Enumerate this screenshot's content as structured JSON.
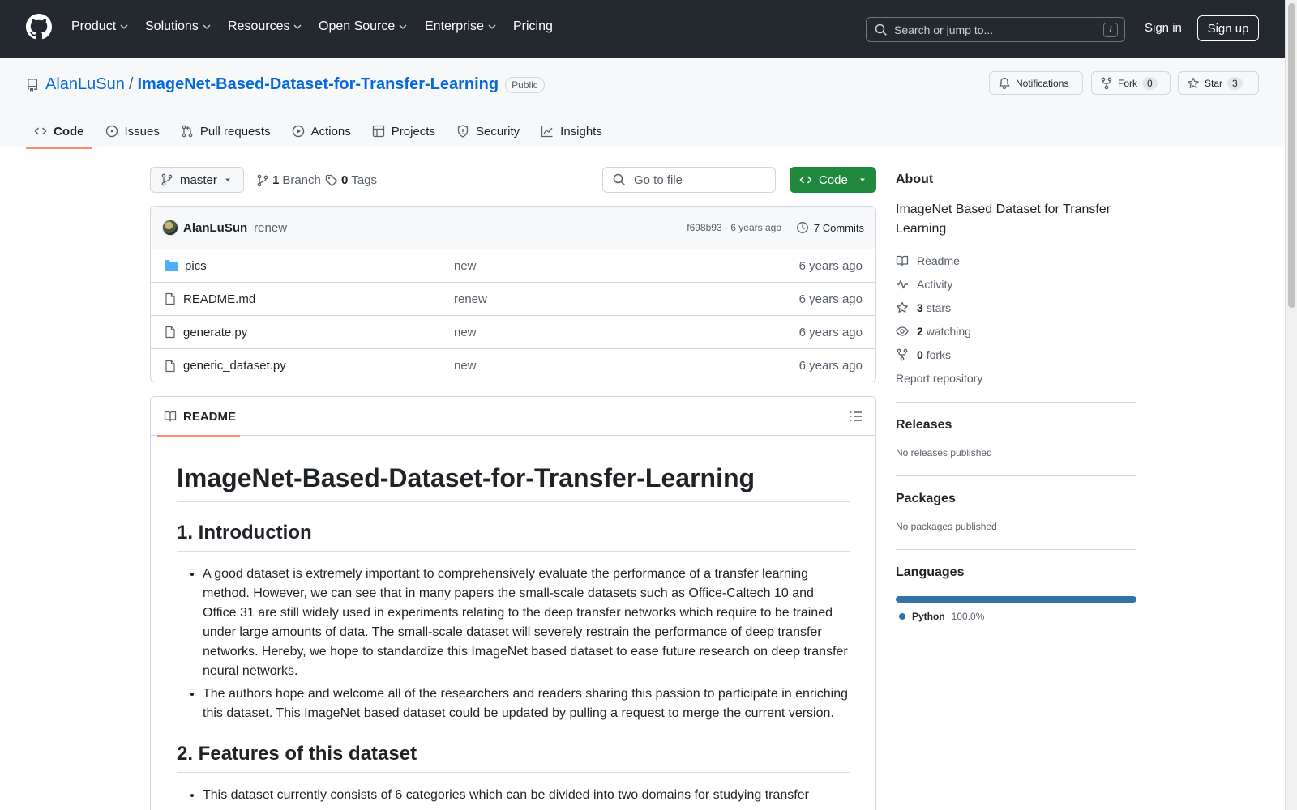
{
  "header": {
    "nav": [
      "Product",
      "Solutions",
      "Resources",
      "Open Source",
      "Enterprise",
      "Pricing"
    ],
    "search_placeholder": "Search or jump to...",
    "search_key": "/",
    "sign_in": "Sign in",
    "sign_up": "Sign up"
  },
  "repo": {
    "owner": "AlanLuSun",
    "separator": "/",
    "name": "ImageNet-Based-Dataset-for-Transfer-Learning",
    "visibility": "Public",
    "notifications": "Notifications",
    "fork_label": "Fork",
    "fork_count": "0",
    "star_label": "Star",
    "star_count": "3"
  },
  "tabs": [
    "Code",
    "Issues",
    "Pull requests",
    "Actions",
    "Projects",
    "Security",
    "Insights"
  ],
  "toolbar": {
    "branch": "master",
    "branch_count": "1",
    "branch_label": "Branch",
    "tag_count": "0",
    "tag_label": "Tags",
    "go_to_file": "Go to file",
    "code_button": "Code"
  },
  "commit": {
    "author": "AlanLuSun",
    "message": "renew",
    "hash_time": "f698b93 · 6 years ago",
    "commits": "7 Commits"
  },
  "files": [
    {
      "name": "pics",
      "type": "folder",
      "message": "new",
      "date": "6 years ago"
    },
    {
      "name": "README.md",
      "type": "file",
      "message": "renew",
      "date": "6 years ago"
    },
    {
      "name": "generate.py",
      "type": "file",
      "message": "new",
      "date": "6 years ago"
    },
    {
      "name": "generic_dataset.py",
      "type": "file",
      "message": "new",
      "date": "6 years ago"
    }
  ],
  "readme": {
    "tab": "README",
    "title": "ImageNet-Based-Dataset-for-Transfer-Learning",
    "h_intro": "1. Introduction",
    "intro_1": "A good dataset is extremely important to comprehensively evaluate the performance of a transfer learning method. However, we can see that in many papers the small-scale datasets such as Office-Caltech 10 and Office 31 are still widely used in experiments relating to the deep transfer networks which require to be trained under large amounts of data. The small-scale dataset will severely restrain the performance of deep transfer networks. Hereby, we hope to standardize this ImageNet based dataset to ease future research on deep transfer neural networks.",
    "intro_2": "The authors hope and welcome all of the researchers and readers sharing this passion to participate in enriching this dataset. This ImageNet based dataset could be updated by pulling a request to merge the current version.",
    "h_features": "2. Features of this dataset",
    "features_1": "This dataset currently consists of 6 categories which can be divided into two domains for studying transfer"
  },
  "sidebar": {
    "about_title": "About",
    "about_desc": "ImageNet Based Dataset for Transfer Learning",
    "readme": "Readme",
    "activity": "Activity",
    "stars_count": "3",
    "stars_label": "stars",
    "watching_count": "2",
    "watching_label": "watching",
    "forks_count": "0",
    "forks_label": "forks",
    "report": "Report repository",
    "releases_title": "Releases",
    "releases_none": "No releases published",
    "packages_title": "Packages",
    "packages_none": "No packages published",
    "languages_title": "Languages",
    "lang_name": "Python",
    "lang_pct": "100.0%",
    "lang_color": "#3572A5"
  }
}
